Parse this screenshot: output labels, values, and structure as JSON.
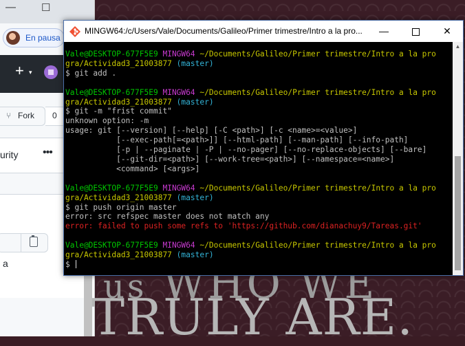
{
  "browser": {
    "minimize_glyph": "—",
    "maximize_glyph": "☐",
    "profile_label": "En pausa",
    "plus_glyph": "+",
    "caret_glyph": "▾",
    "fork_icon_glyph": "⑂",
    "fork_label": "Fork",
    "fork_count": "0",
    "tab_label": "urity",
    "more_glyph": "•••",
    "stray_text": "a"
  },
  "wallpaper": {
    "line1_small": "us",
    "line1": " WHO WE",
    "line2": "TRULY ARE."
  },
  "terminal": {
    "title": "MINGW64:/c/Users/Vale/Documents/Galileo/Primer trimestre/Intro a la pro...",
    "minimize_glyph": "—",
    "close_glyph": "✕",
    "scroll_up_glyph": "▲",
    "blocks": [
      {
        "user": "Vale@DESKTOP-677F5E9",
        "sys": "MINGW64",
        "path_part1": "~/Documents/Galileo/Primer trimestre/Intro a la pro",
        "path_part2": "gra/Actividad3_21003877",
        "branch": "(master)",
        "command": "$ git add .",
        "output": "",
        "error": ""
      },
      {
        "user": "Vale@DESKTOP-677F5E9",
        "sys": "MINGW64",
        "path_part1": "~/Documents/Galileo/Primer trimestre/Intro a la pro",
        "path_part2": "gra/Actividad3_21003877",
        "branch": "(master)",
        "command": "$ git -m \"frist commit\"",
        "output": "unknown option: -m\nusage: git [--version] [--help] [-C <path>] [-c <name>=<value>]\n           [--exec-path[=<path>]] [--html-path] [--man-path] [--info-path]\n           [-p | --paginate | -P | --no-pager] [--no-replace-objects] [--bare]\n           [--git-dir=<path>] [--work-tree=<path>] [--namespace=<name>]\n           <command> [<args>]",
        "error": ""
      },
      {
        "user": "Vale@DESKTOP-677F5E9",
        "sys": "MINGW64",
        "path_part1": "~/Documents/Galileo/Primer trimestre/Intro a la pro",
        "path_part2": "gra/Actividad3_21003877",
        "branch": "(master)",
        "command": "$ git push origin master",
        "output": "error: src refspec master does not match any",
        "error": "error: failed to push some refs to 'https://github.com/dianachuy9/Tareas.git'"
      },
      {
        "user": "Vale@DESKTOP-677F5E9",
        "sys": "MINGW64",
        "path_part1": "~/Documents/Galileo/Primer trimestre/Intro a la pro",
        "path_part2": "gra/Actividad3_21003877",
        "branch": "(master)",
        "command": "$ ",
        "output": "",
        "error": ""
      }
    ],
    "colors": {
      "user": "#00c700",
      "sys": "#c83ad0",
      "path": "#c8c800",
      "branch": "#33b4d8",
      "error": "#dd2222",
      "text": "#c0c0c0",
      "background": "#000000"
    }
  }
}
